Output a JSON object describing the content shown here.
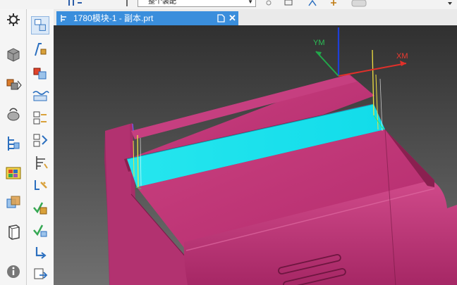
{
  "toolbar": {
    "selection_filter_value": "整个装配",
    "colors": {
      "toolbar_bg": "#f3f3f3"
    }
  },
  "tab": {
    "title": "1780模块-1 - 副本.prt",
    "close_glyph": "✕",
    "accent": "#3a8edc"
  },
  "viewport": {
    "background_top": "#3a3a3a",
    "background_bottom": "#6a6a6a",
    "part_color": "#c2357d",
    "toolpath_face_color": "#1ee8ee",
    "axes": {
      "x_label": "XM",
      "y_label": "YM",
      "x_color": "#e0302a",
      "y_color": "#22a84a",
      "z_color": "#1e3fd8"
    }
  },
  "resource_bar": {
    "icons": [
      "gear-icon",
      "part-cube-icon",
      "assembly-icon",
      "constraint-icon",
      "navigator-icon",
      "palette-icon",
      "history-icon",
      "part-outline-icon",
      "info-icon"
    ]
  },
  "tool_column": {
    "icons": [
      "program-order-view-icon",
      "machine-tool-view-icon",
      "geometry-view-icon",
      "method-view-icon",
      "create-operation-icon",
      "create-program-icon",
      "create-tool-icon",
      "create-geometry-icon",
      "verify-toolpath-icon",
      "post-process-icon",
      "shop-doc-icon",
      "export-icon",
      "import-icon"
    ]
  }
}
